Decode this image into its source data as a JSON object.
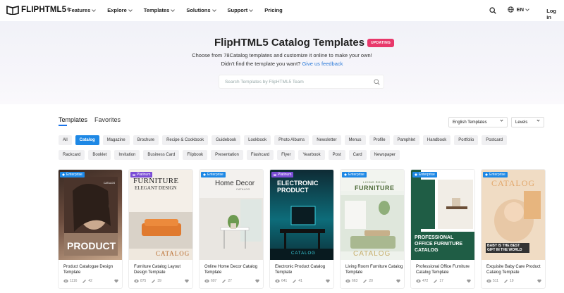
{
  "header": {
    "logo_text": "FLIPHTML5",
    "logo_reg": "®",
    "nav": [
      {
        "label": "Features"
      },
      {
        "label": "Explore"
      },
      {
        "label": "Templates"
      },
      {
        "label": "Solutions"
      },
      {
        "label": "Support"
      },
      {
        "label": "Pricing"
      }
    ],
    "language": "EN",
    "login": "Log in"
  },
  "hero": {
    "title": "FlipHTML5 Catalog Templates",
    "badge": "UPDATING",
    "subtitle": "Choose from 78Catalog templates and customize it online to make your own!",
    "subtitle2": "Didn't find the template you want?",
    "feedback_link": "Give us feedback",
    "search_placeholder": "Search Templates by FlipHTML5 Team"
  },
  "tabs": [
    {
      "label": "Templates",
      "active": true
    },
    {
      "label": "Favorites",
      "active": false
    }
  ],
  "filters": {
    "type_select": "English Templates",
    "level_select": "Levels"
  },
  "chips_row1": [
    "All",
    "Catalog",
    "Magazine",
    "Brochure",
    "Recipe & Cookbook",
    "Guidebook",
    "Lookbook",
    "Photo Albums",
    "Newsletter",
    "Menus",
    "Profile",
    "Pamphlet",
    "Handbook",
    "Portfolio",
    "Postcard"
  ],
  "chips_row2": [
    "Rackcard",
    "Booklet",
    "Invitation",
    "Business Card",
    "Flipbook",
    "Presentation",
    "Flashcard",
    "Flyer",
    "Yearbook",
    "Post",
    "Card",
    "Newspaper"
  ],
  "active_chip": "Catalog",
  "colors": {
    "accent": "#1e88e5",
    "badge": "#e8386b",
    "enterprise": "#1e88e5",
    "platinum": "#7b4dd6"
  },
  "cards": [
    {
      "tier": "Enterprise",
      "title": "Product Catalogue Design Template",
      "views": "1116",
      "edits": "42",
      "cover_text": "PRODUCT",
      "cover_top": "CATALOG"
    },
    {
      "tier": "Platinum",
      "title": "Furniture Catalog Layout Design Template",
      "views": "875",
      "edits": "39",
      "cover_text": "FURNITURE",
      "cover_sub": "ELEGANT DESIGN",
      "cover_bottom": "CATALOG"
    },
    {
      "tier": "Enterprise",
      "title": "Online Home Decor Catalog Template",
      "views": "607",
      "edits": "27",
      "cover_text": "Home Decor",
      "cover_sub": "CATALOG"
    },
    {
      "tier": "Platinum",
      "title": "Electronic Product Catalog Template",
      "views": "641",
      "edits": "41",
      "cover_text": "ELECTRONIC PRODUCT",
      "cover_sub": "CATALOG"
    },
    {
      "tier": "Enterprise",
      "title": "Living Room Furniture Catalog Template",
      "views": "663",
      "edits": "20",
      "cover_text": "FURNITURE",
      "cover_sub": "LIVING ROOM",
      "cover_bottom": "CATALOG"
    },
    {
      "tier": "Enterprise",
      "title": "Professional Office Furniture Catalog Template",
      "views": "472",
      "edits": "17",
      "cover_text": "PROFESSIONAL OFFICE FURNITURE CATALOG"
    },
    {
      "tier": "Enterprise",
      "title": "Exquisite Baby Care Product Catalog Template",
      "views": "511",
      "edits": "19",
      "cover_text": "CATALOG",
      "cover_sub": "BABY IS THE BEST GIFT IN THE WORLD"
    }
  ]
}
